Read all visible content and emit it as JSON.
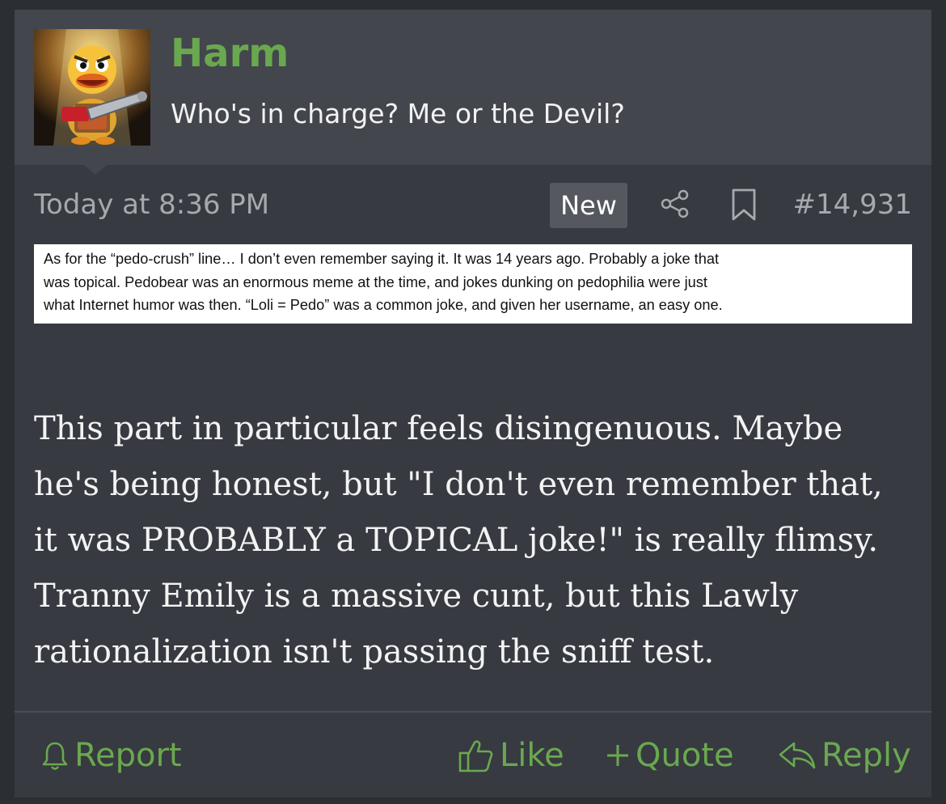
{
  "user": {
    "name": "Harm",
    "title": "Who's in charge? Me or the Devil?"
  },
  "meta": {
    "timestamp": "Today at 8:36 PM",
    "badge": "New",
    "post_number": "#14,931"
  },
  "quote_lines": [
    "As for the “pedo-crush” line… I don’t even remember saying it. It was 14 years ago. Probably a joke that",
    "was topical. Pedobear was an enormous meme at the time, and jokes dunking on pedophilia were just",
    "what Internet humor was then. “Loli = Pedo” was a common joke, and given her username, an easy one."
  ],
  "body": "This part in particular feels disingenuous. Maybe he's being honest, but \"I don't even remember that, it was PROBABLY a TOPICAL joke!\" is really flimsy. Tranny Emily is a massive cunt, but this Lawly rationalization isn't passing the sniff test.",
  "actions": {
    "report": "Report",
    "like": "Like",
    "quote": "Quote",
    "reply": "Reply"
  },
  "colors": {
    "accent": "#6aa84f",
    "background": "#373a41",
    "header": "#43464d",
    "muted_text": "#a6a9ae"
  },
  "icons": [
    "avatar-duck-chainsaw",
    "share-icon",
    "bookmark-icon",
    "bell-icon",
    "thumbs-up-icon",
    "plus-icon",
    "reply-arrow-icon"
  ]
}
